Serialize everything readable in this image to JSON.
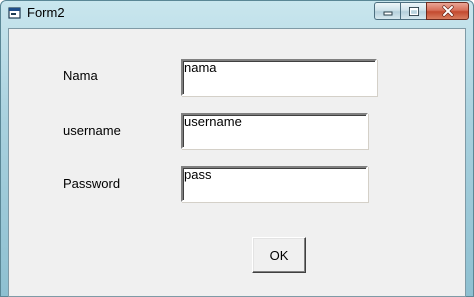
{
  "window": {
    "title": "Form2"
  },
  "form": {
    "nama_label": "Nama",
    "nama_value": "nama",
    "username_label": "username",
    "username_value": "username",
    "password_label": "Password",
    "password_value": "pass",
    "ok_label": "OK"
  },
  "icons": {
    "app": "form-window-icon",
    "minimize": "minimize-icon",
    "maximize": "maximize-icon",
    "close": "close-icon"
  }
}
